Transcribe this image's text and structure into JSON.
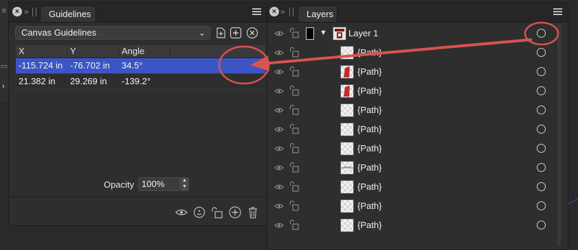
{
  "guidelines_panel": {
    "tab_title": "Guidelines",
    "dropdown_value": "Canvas Guidelines",
    "columns": [
      "X",
      "Y",
      "Angle"
    ],
    "rows": [
      {
        "x": "-115.724 in",
        "y": "-76.702 in",
        "angle": "34.5°",
        "selected": true
      },
      {
        "x": "21.382 in",
        "y": "29.269 in",
        "angle": "-139.2°",
        "selected": false
      }
    ],
    "opacity_label": "Opacity",
    "opacity_value": "100%",
    "tools": [
      "eye-icon",
      "smile-icon",
      "lock-icon",
      "add-icon",
      "trash-icon"
    ]
  },
  "layers_panel": {
    "tab_title": "Layers",
    "layers": [
      {
        "name": "Layer 1",
        "thumb": "layer"
      },
      {
        "name": "{Path}",
        "thumb": "checker"
      },
      {
        "name": "{Path}",
        "thumb": "red"
      },
      {
        "name": "{Path}",
        "thumb": "red"
      },
      {
        "name": "{Path}",
        "thumb": "checker"
      },
      {
        "name": "{Path}",
        "thumb": "checker"
      },
      {
        "name": "{Path}",
        "thumb": "checker"
      },
      {
        "name": "{Path}",
        "thumb": "line"
      },
      {
        "name": "{Path}",
        "thumb": "checker"
      },
      {
        "name": "{Path}",
        "thumb": "checker"
      },
      {
        "name": "{Path}",
        "thumb": "checker"
      }
    ]
  },
  "colors": {
    "selection": "#3b56c4",
    "annotation": "#d9534f"
  }
}
